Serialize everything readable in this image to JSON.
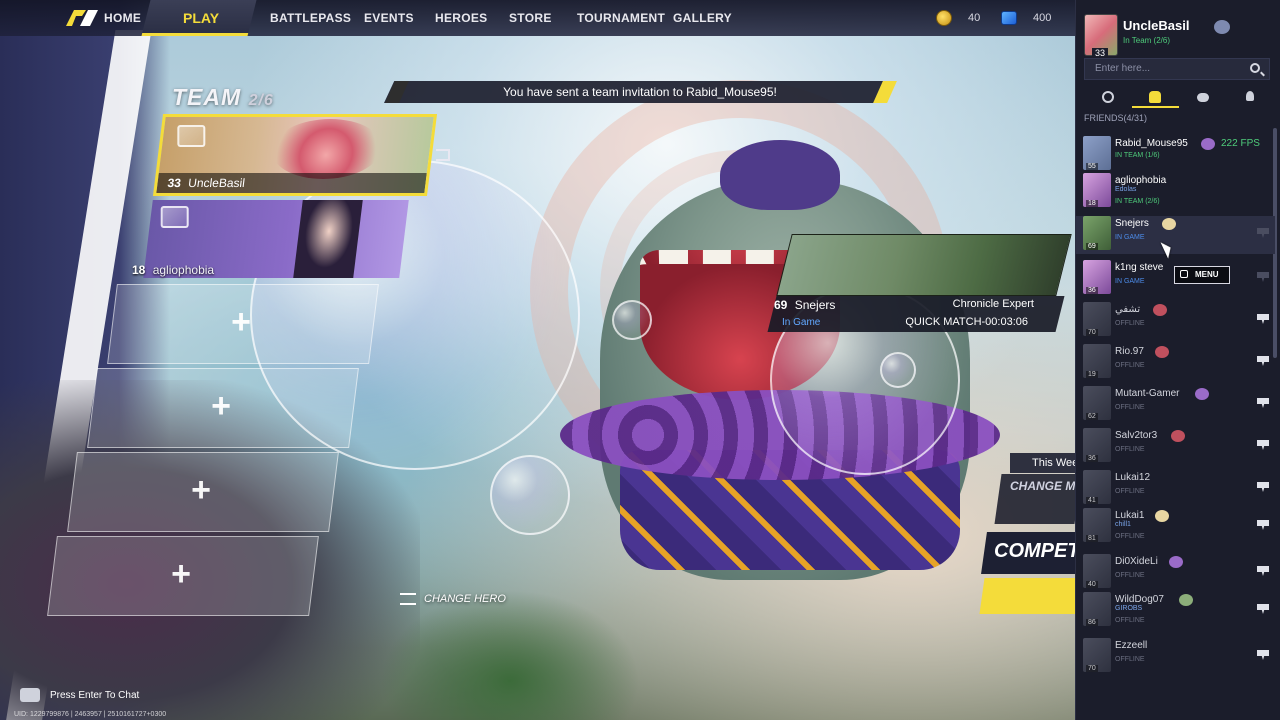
{
  "nav": {
    "home": "HOME",
    "play": "PLAY",
    "items": [
      "BATTLEPASS",
      "EVENTS",
      "HEROES",
      "STORE",
      "TOURNAMENT",
      "GALLERY"
    ],
    "gold": "40",
    "gems": "400"
  },
  "banner": {
    "text": "You have sent a team invitation to Rabid_Mouse95!"
  },
  "team": {
    "title": "TEAM",
    "count": "2/6",
    "members": [
      {
        "level": "33",
        "name": "UncleBasil"
      },
      {
        "level": "18",
        "name": "agliophobia"
      }
    ]
  },
  "hovercard": {
    "level": "69",
    "name": "Snejers",
    "title": "Chronicle Expert",
    "status": "In Game",
    "match": "QUICK MATCH-00:03:06"
  },
  "change_hero": "CHANGE HERO",
  "mode": {
    "week": "This Wee",
    "change": "CHANGE MO",
    "competitive": "COMPETITI"
  },
  "chat": {
    "prompt": "Press Enter To Chat",
    "uid": "UID: 1229799876 | 2463957 | 2510161727+0300"
  },
  "me": {
    "name": "UncleBasil",
    "level": "33",
    "status": "In Team (2/6)"
  },
  "search": {
    "placeholder": "Enter here..."
  },
  "friends_label": "FRIENDS(4/31)",
  "menu_tip": "MENU",
  "friends": [
    {
      "name": "Rabid_Mouse95",
      "level": "55",
      "sub": "",
      "status": "IN TEAM (1/6)",
      "fps": "222 FPS"
    },
    {
      "name": "agliophobia",
      "level": "18",
      "sub": "Edolas",
      "status": "IN TEAM (2/6)"
    },
    {
      "name": "Snejers",
      "level": "69",
      "sub": "",
      "status": "IN GAME"
    },
    {
      "name": "k1ng steve",
      "level": "36",
      "sub": "",
      "status": "IN GAME"
    },
    {
      "name": "تشفي",
      "level": "70",
      "sub": "",
      "status": "OFFLINE"
    },
    {
      "name": "Rio.97",
      "level": "19",
      "sub": "",
      "status": "OFFLINE"
    },
    {
      "name": "Mutant-Gamer",
      "level": "62",
      "sub": "",
      "status": "OFFLINE"
    },
    {
      "name": "Salv2tor3",
      "level": "36",
      "sub": "",
      "status": "OFFLINE"
    },
    {
      "name": "Lukai12",
      "level": "41",
      "sub": "",
      "status": "OFFLINE"
    },
    {
      "name": "Lukai1",
      "level": "81",
      "sub": "chill1",
      "status": "OFFLINE"
    },
    {
      "name": "Di0XideLi",
      "level": "40",
      "sub": "",
      "status": "OFFLINE"
    },
    {
      "name": "WildDog07",
      "level": "86",
      "sub": "GIROBS",
      "status": "OFFLINE"
    },
    {
      "name": "Ezzeell",
      "level": "70",
      "sub": "",
      "status": "OFFLINE"
    }
  ]
}
